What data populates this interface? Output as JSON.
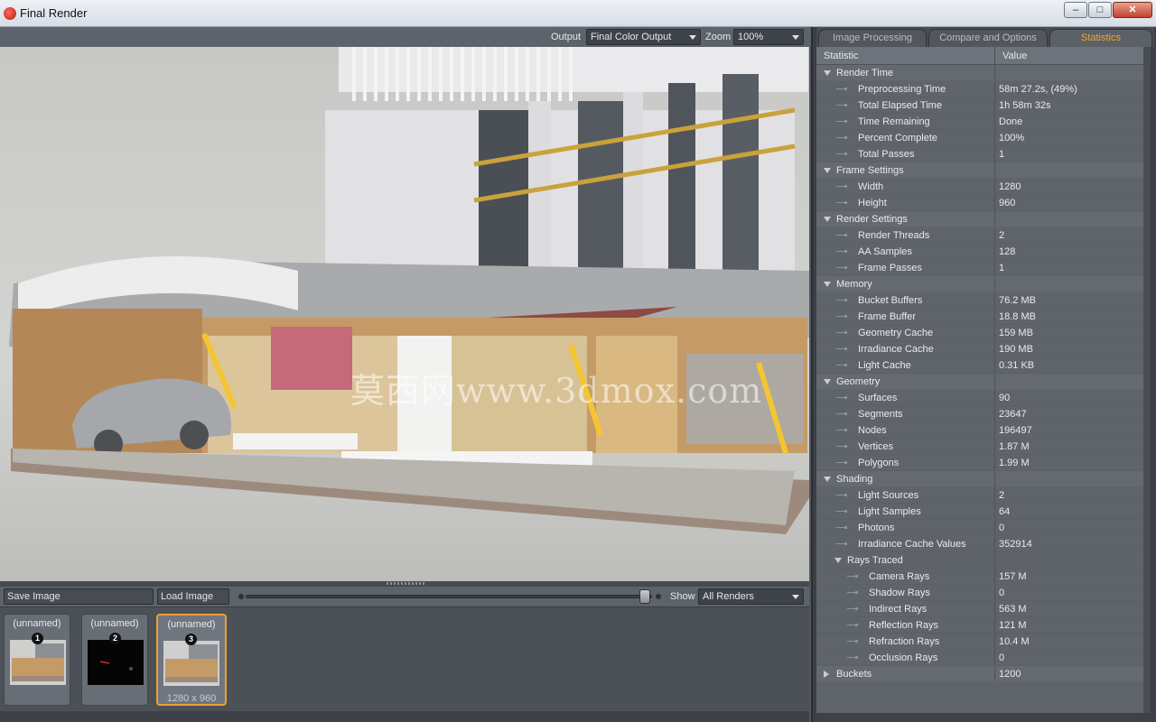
{
  "window": {
    "title": "Final Render",
    "buttons": [
      "–",
      "□",
      "✕"
    ]
  },
  "toolbar": {
    "output_label": "Output",
    "output_value": "Final Color Output",
    "zoom_label": "Zoom",
    "zoom_value": "100%"
  },
  "watermark": "莫西网www.3dmox.com",
  "bottom": {
    "save_label": "Save Image",
    "load_label": "Load Image",
    "show_label": "Show",
    "show_value": "All Renders"
  },
  "thumbnails": [
    {
      "name": "(unnamed)",
      "badge": "1",
      "size": ""
    },
    {
      "name": "(unnamed)",
      "badge": "2",
      "size": ""
    },
    {
      "name": "(unnamed)",
      "badge": "3",
      "size": "1280 x 960"
    }
  ],
  "tabs": [
    "Image Processing",
    "Compare and Options",
    "Statistics"
  ],
  "stats": {
    "headers": [
      "Statistic",
      "Value"
    ],
    "rows": [
      {
        "level": 0,
        "group": true,
        "name": "Render Time",
        "value": ""
      },
      {
        "level": 1,
        "name": "Preprocessing Time",
        "value": "58m 27.2s, (49%)"
      },
      {
        "level": 1,
        "name": "Total Elapsed Time",
        "value": "1h 58m 32s"
      },
      {
        "level": 1,
        "name": "Time Remaining",
        "value": "Done"
      },
      {
        "level": 1,
        "name": "Percent Complete",
        "value": "100%"
      },
      {
        "level": 1,
        "name": "Total Passes",
        "value": "1"
      },
      {
        "level": 0,
        "group": true,
        "name": "Frame Settings",
        "value": ""
      },
      {
        "level": 1,
        "name": "Width",
        "value": "1280"
      },
      {
        "level": 1,
        "name": "Height",
        "value": "960"
      },
      {
        "level": 0,
        "group": true,
        "name": "Render Settings",
        "value": ""
      },
      {
        "level": 1,
        "name": "Render Threads",
        "value": "2"
      },
      {
        "level": 1,
        "name": "AA Samples",
        "value": "128"
      },
      {
        "level": 1,
        "name": "Frame Passes",
        "value": "1"
      },
      {
        "level": 0,
        "group": true,
        "name": "Memory",
        "value": ""
      },
      {
        "level": 1,
        "name": "Bucket Buffers",
        "value": "76.2 MB"
      },
      {
        "level": 1,
        "name": "Frame Buffer",
        "value": "18.8 MB"
      },
      {
        "level": 1,
        "name": "Geometry Cache",
        "value": "159 MB"
      },
      {
        "level": 1,
        "name": "Irradiance Cache",
        "value": "190 MB"
      },
      {
        "level": 1,
        "name": "Light Cache",
        "value": "0.31 KB"
      },
      {
        "level": 0,
        "group": true,
        "name": "Geometry",
        "value": ""
      },
      {
        "level": 1,
        "name": "Surfaces",
        "value": "90"
      },
      {
        "level": 1,
        "name": "Segments",
        "value": "23647"
      },
      {
        "level": 1,
        "name": "Nodes",
        "value": "196497"
      },
      {
        "level": 1,
        "name": "Vertices",
        "value": "1.87 M"
      },
      {
        "level": 1,
        "name": "Polygons",
        "value": "1.99 M"
      },
      {
        "level": 0,
        "group": true,
        "name": "Shading",
        "value": ""
      },
      {
        "level": 1,
        "name": "Light Sources",
        "value": "2"
      },
      {
        "level": 1,
        "name": "Light Samples",
        "value": "64"
      },
      {
        "level": 1,
        "name": "Photons",
        "value": "0"
      },
      {
        "level": 1,
        "name": "Irradiance Cache Values",
        "value": "352914"
      },
      {
        "level": 1,
        "group": true,
        "name": "Rays Traced",
        "value": ""
      },
      {
        "level": 2,
        "name": "Camera Rays",
        "value": "157 M"
      },
      {
        "level": 2,
        "name": "Shadow Rays",
        "value": "0"
      },
      {
        "level": 2,
        "name": "Indirect Rays",
        "value": "563 M"
      },
      {
        "level": 2,
        "name": "Reflection Rays",
        "value": "121 M"
      },
      {
        "level": 2,
        "name": "Refraction Rays",
        "value": "10.4 M"
      },
      {
        "level": 2,
        "name": "Occlusion Rays",
        "value": "0"
      },
      {
        "level": 0,
        "group": true,
        "collapsed": true,
        "name": "Buckets",
        "value": "1200"
      }
    ]
  },
  "colors": {
    "accent": "#f7a623",
    "panel": "#5f646b"
  }
}
